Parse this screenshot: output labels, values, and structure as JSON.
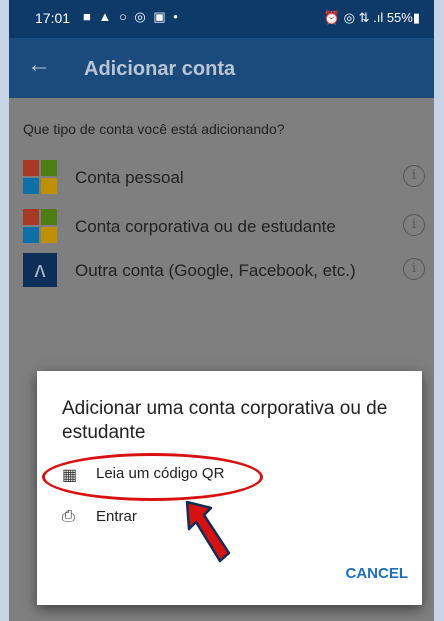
{
  "status_bar": {
    "time": "17:01",
    "left_icons": "■ ▲ ○ ◎ ▣ •",
    "right": "⏰ ◎ ⇅ .ıl 55%▮"
  },
  "app_bar": {
    "title": "Adicionar conta"
  },
  "question": "Que tipo de conta você está adicionando?",
  "account_types": [
    {
      "label": "Conta pessoal",
      "icon": "microsoft-logo-icon"
    },
    {
      "label": "Conta corporativa ou de estudante",
      "icon": "microsoft-logo-icon"
    },
    {
      "label": "Outra conta (Google, Facebook, etc.)",
      "icon": "person-icon"
    }
  ],
  "dialog": {
    "title": "Adicionar uma conta corporativa ou de estudante",
    "options": [
      {
        "label": "Leia um código QR",
        "icon": "qr-code-icon"
      },
      {
        "label": "Entrar",
        "icon": "badge-icon"
      }
    ],
    "cancel_label": "CANCEL"
  },
  "colors": {
    "app_bar": "#1b4b7d",
    "status_bar": "#0e3a6a",
    "highlight": "#d91010",
    "arrow": "#d91010",
    "accent": "#1e6fc4"
  }
}
